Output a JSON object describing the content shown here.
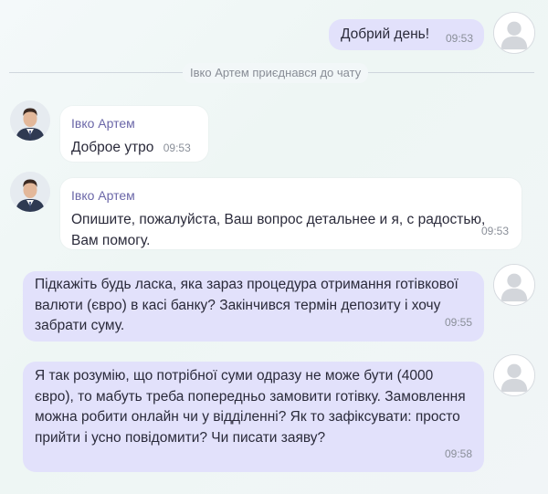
{
  "messages": [
    {
      "kind": "out",
      "text": "Добрий день!",
      "time": "09:53"
    },
    {
      "kind": "in",
      "sender": "Івко Артем",
      "text": "Доброе утро",
      "time": "09:53"
    },
    {
      "kind": "in",
      "sender": "Івко Артем",
      "text": "Опишите, пожалуйста, Ваш вопрос детальнее и я, с радостью, Вам помогу.",
      "time": "09:53"
    },
    {
      "kind": "out",
      "text": "Підкажіть будь ласка, яка зараз процедура отримання готівкової валюти (євро) в касі банку? Закінчився термін депозиту і хочу забрати суму.",
      "time": "09:55"
    },
    {
      "kind": "out",
      "text": "Я так розумію, що потрібної суми одразу не може бути (4000 євро), то мабуть треба попередньо замовити готівку. Замовлення можна робити онлайн чи у відділенні? Як то зафіксувати: просто прийти і усно повідомити? Чи писати заяву?",
      "time": "09:58"
    }
  ],
  "system_notice": "Івко Артем приєднався до чату",
  "colors": {
    "outgoing_bubble": "#e2e1fb",
    "incoming_bubble": "#ffffff",
    "sender_name": "#6b67a8"
  },
  "icons": {
    "user_avatar": "default-user-avatar-icon",
    "agent_avatar": "agent-photo-avatar"
  }
}
